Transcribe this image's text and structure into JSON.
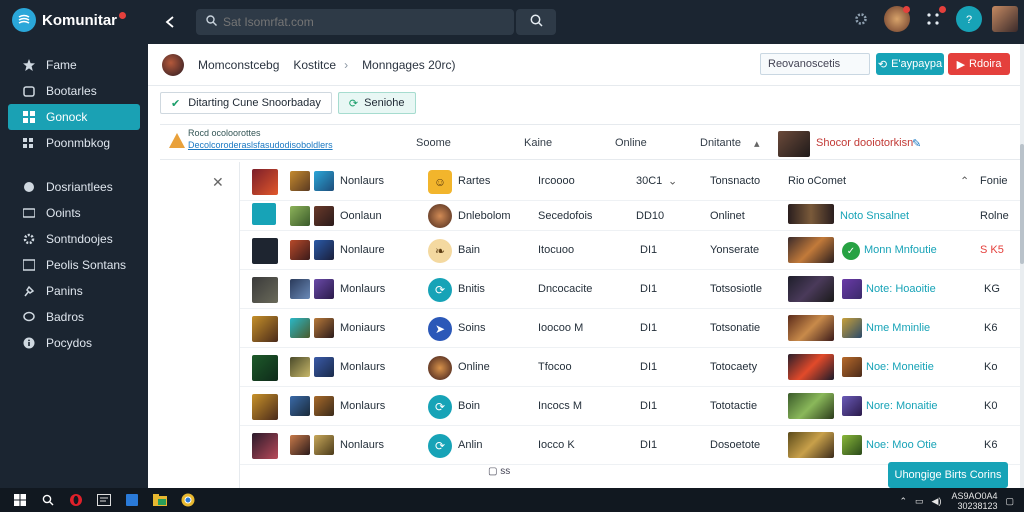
{
  "app": {
    "name": "Komunitar"
  },
  "colors": {
    "accent": "#17a3b7",
    "danger": "#e4403c",
    "sidebar": "#1b2531"
  },
  "sidebar": {
    "items": [
      {
        "label": "Fame",
        "icon": "star-icon"
      },
      {
        "label": "Bootarles",
        "icon": "box-icon"
      },
      {
        "label": "Gonock",
        "icon": "grid-icon",
        "active": true
      },
      {
        "label": "Poonmbkog",
        "icon": "apps-icon"
      },
      {
        "label": "Dosriantlees",
        "icon": "circle-icon"
      },
      {
        "label": "Ooints",
        "icon": "card-icon"
      },
      {
        "label": "Sontndoojes",
        "icon": "gear-icon"
      },
      {
        "label": "Peolis Sontans",
        "icon": "screen-icon"
      },
      {
        "label": "Panins",
        "icon": "pin-icon"
      },
      {
        "label": "Badros",
        "icon": "chat-icon"
      },
      {
        "label": "Pocydos",
        "icon": "info-icon"
      }
    ]
  },
  "search": {
    "placeholder": "Sat Isomrfat.com"
  },
  "breadcrumb": {
    "items": [
      "Momconstcebg",
      "Kostitce",
      "Monngages 20rc)"
    ]
  },
  "toolbar": {
    "input_value": "Reovanoscetis",
    "teal_button": "E'aypaypa",
    "red_button": "Rdoira"
  },
  "filters": {
    "first": "Ditarting Cune Snoorbaday",
    "second": "Seniohe"
  },
  "table": {
    "link_text_1": "Rocd ocoloorottes",
    "link_text_2": "Decolcoroderaslsfasudodisoboldlers",
    "headers": [
      "Soome",
      "Kaine",
      "Online",
      "Dnitante",
      "Shocor dooiotorkisn"
    ],
    "rows": [
      {
        "name": "Nonlaurs",
        "type": "Rartes",
        "value": "Ircoooo",
        "code": "30C1",
        "status": "Tonsnacto",
        "note": "Rio oComet",
        "end": "Fonie"
      },
      {
        "name": "Oonlaun",
        "type": "Dnlebolom",
        "value": "Secedofois",
        "code": "DD10",
        "status": "Onlinet",
        "note": "Noto Snsalnet",
        "end": "Rolne"
      },
      {
        "name": "Nonlaure",
        "type": "Bain",
        "value": "Itocuoo",
        "code": "DI1",
        "status": "Yonserate",
        "note": "Monn Mnfoutie",
        "end": "S K5"
      },
      {
        "name": "Monlaurs",
        "type": "Bnitis",
        "value": "Dncocacite",
        "code": "DI1",
        "status": "Totsosiotle",
        "note": "Note: Hoaoitie",
        "end": "KG"
      },
      {
        "name": "Moniaurs",
        "type": "Soins",
        "value": "Ioocoo M",
        "code": "DI1",
        "status": "Totsonatie",
        "note": "Nme Mminlie",
        "end": "K6"
      },
      {
        "name": "Monlaurs",
        "type": "Online",
        "value": "Tfocoo",
        "code": "DI1",
        "status": "Totocaety",
        "note": "Noe: Moneitie",
        "end": "Ko"
      },
      {
        "name": "Monlaurs",
        "type": "Boin",
        "value": "Incocs M",
        "code": "DI1",
        "status": "Tototactie",
        "note": "Nore: Monaitie",
        "end": "K0"
      },
      {
        "name": "Nonlaurs",
        "type": "Anlin",
        "value": "Iocco K",
        "code": "DI1",
        "status": "Dosoetote",
        "note": "Noe: Moo Otie",
        "end": "K6"
      }
    ]
  },
  "pager": {
    "label": "ss"
  },
  "float_button": "Uhongige Birts Corins",
  "taskbar": {
    "clock_time": "AS9AO0A4",
    "clock_date": "30238123"
  }
}
